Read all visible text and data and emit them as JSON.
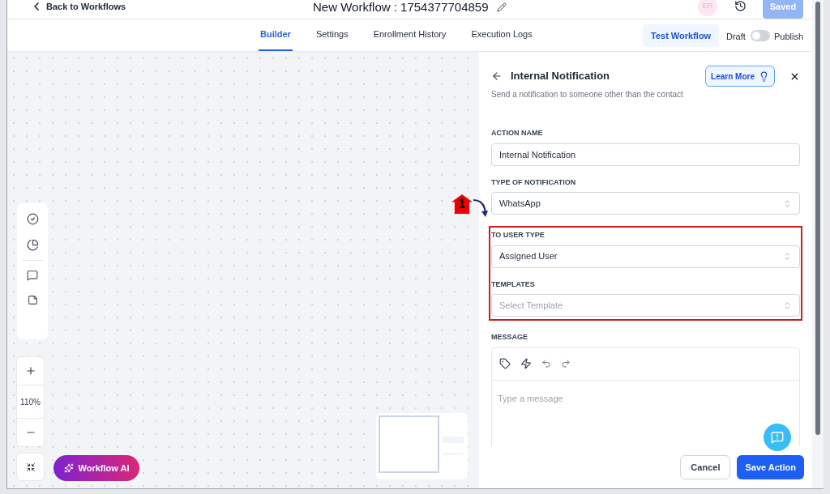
{
  "header": {
    "back_label": "Back to Workflows",
    "title": "New Workflow : 1754377704859",
    "avatar": "ER",
    "save_button": {
      "label": "Saved",
      "disabled": true
    }
  },
  "tabs": [
    {
      "label": "Builder",
      "selected": true
    },
    {
      "label": "Settings",
      "selected": false
    },
    {
      "label": "Enrollment History",
      "selected": false
    },
    {
      "label": "Execution Logs",
      "selected": false
    }
  ],
  "test_button": "Test Workflow",
  "publish_toggle": {
    "off_label": "Draft",
    "on_label": "Publish",
    "on": false
  },
  "canvas": {
    "zoom": "110%",
    "ai_button": "Workflow AI"
  },
  "panel": {
    "title": "Internal Notification",
    "learn_more": "Learn More",
    "subtitle": "Send a notification to someone other than the contact",
    "fields": [
      {
        "kind": "text",
        "label": "ACTION NAME",
        "value": "Internal Notification",
        "highlighted": false
      },
      {
        "kind": "select",
        "label": "TYPE OF NOTIFICATION",
        "value": "WhatsApp",
        "highlighted": false
      },
      {
        "kind": "select",
        "label": "TO USER TYPE",
        "value": "Assigned User",
        "highlighted": true
      },
      {
        "kind": "select",
        "label": "TEMPLATES",
        "placeholder": "Select Template",
        "highlighted": true
      }
    ],
    "message": {
      "label": "MESSAGE",
      "placeholder": "Type a message"
    },
    "cancel_button": "Cancel",
    "save_button": "Save Action"
  },
  "annotation": {
    "number": "1"
  }
}
